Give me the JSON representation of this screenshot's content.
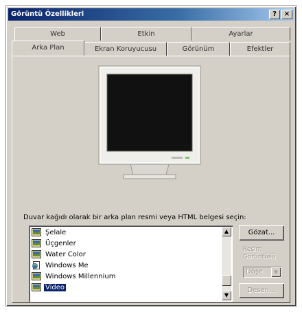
{
  "window": {
    "title": "Görüntü Özellikleri",
    "help_label": "?",
    "close_label": "×"
  },
  "tabs": {
    "row1": [
      "Web",
      "Etkin",
      "Ayarlar"
    ],
    "row2": [
      "Arka Plan",
      "Ekran Koruyucusu",
      "Görünüm",
      "Efektler"
    ],
    "active": "Arka Plan"
  },
  "main": {
    "prompt": "Duvar kağıdı olarak bir arka plan resmi veya HTML belgesi seçin:",
    "wallpapers": [
      {
        "label": "Şelale",
        "icon": "image-file-icon"
      },
      {
        "label": "Üçgenler",
        "icon": "image-file-icon"
      },
      {
        "label": "Water Color",
        "icon": "image-file-icon"
      },
      {
        "label": "Windows Me",
        "icon": "html-document-icon"
      },
      {
        "label": "Windows Millennium",
        "icon": "image-file-icon"
      },
      {
        "label": "Video",
        "icon": "image-file-icon",
        "selected": true
      }
    ],
    "browse_label": "Gözat...",
    "display_label_line1": "Resim",
    "display_label_line2": "Görüntüsü",
    "display_select_value": "Döşe",
    "pattern_label": "Desen..."
  }
}
